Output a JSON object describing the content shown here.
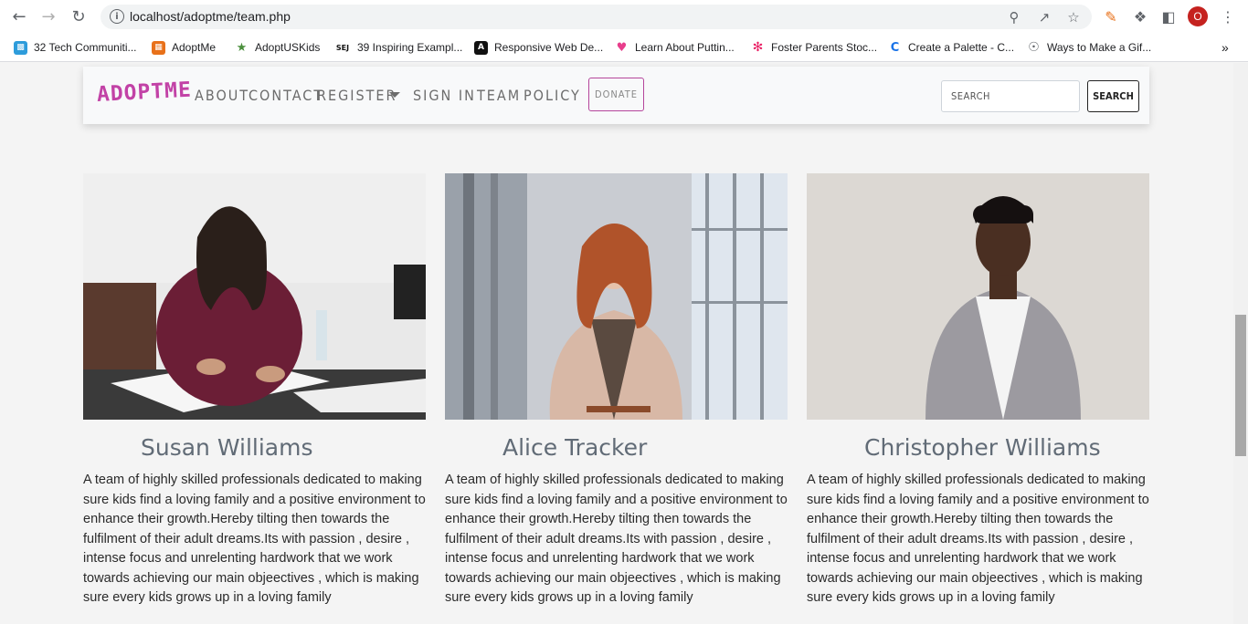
{
  "browser": {
    "url": "localhost/adoptme/team.php",
    "profile_initial": "O",
    "bookmarks": [
      {
        "label": "32 Tech Communiti...",
        "icon": "box-icon",
        "color": "#2d9cdb"
      },
      {
        "label": "AdoptMe",
        "icon": "grid-icon",
        "color": "#e8711a"
      },
      {
        "label": "AdoptUSKids",
        "icon": "person-icon",
        "color": "#4a8f3c"
      },
      {
        "label": "39 Inspiring Exampl...",
        "icon": "sej-icon",
        "color": "#111111"
      },
      {
        "label": "Responsive Web De...",
        "icon": "a-icon",
        "color": "#111111"
      },
      {
        "label": "Learn About Puttin...",
        "icon": "heart-icon",
        "color": "#e83e8c"
      },
      {
        "label": "Foster Parents Stoc...",
        "icon": "swirl-icon",
        "color": "#e91e63"
      },
      {
        "label": "Create a Palette - C...",
        "icon": "c-icon",
        "color": "#1a73e8"
      },
      {
        "label": "Ways to Make a Gif...",
        "icon": "globe-icon",
        "color": "#5f6368"
      }
    ]
  },
  "navbar": {
    "brand": "ADOPTME",
    "links": [
      "ABOUT",
      "CONTACT",
      "REGISTER",
      "SIGN IN",
      "TEAM",
      "POLICY"
    ],
    "donate_label": "DONATE",
    "search_placeholder": "SEARCH",
    "search_button": "SEARCH"
  },
  "team": [
    {
      "name": "Susan Williams",
      "description": "A team of highly skilled professionals dedicated to making sure kids find a loving family and a positive environment to enhance their growth.Hereby tilting then towards the fulfilment of their adult dreams.Its with passion , desire , intense focus and unrelenting hardwork that we work towards achieving our main objeectives , which is making sure every kids grows up in a loving family"
    },
    {
      "name": "Alice Tracker",
      "description": "A team of highly skilled professionals dedicated to making sure kids find a loving family and a positive environment to enhance their growth.Hereby tilting then towards the fulfilment of their adult dreams.Its with passion , desire , intense focus and unrelenting hardwork that we work towards achieving our main objeectives , which is making sure every kids grows up in a loving family"
    },
    {
      "name": "Christopher Williams",
      "description": "A team of highly skilled professionals dedicated to making sure kids find a loving family and a positive environment to enhance their growth.Hereby tilting then towards the fulfilment of their adult dreams.Its with passion , desire , intense focus and unrelenting hardwork that we work towards achieving our main objeectives , which is making sure every kids grows up in a loving family"
    }
  ],
  "colors": {
    "brand": "#c242a6",
    "donate_border": "#b5459b",
    "name_text": "#616b76"
  }
}
